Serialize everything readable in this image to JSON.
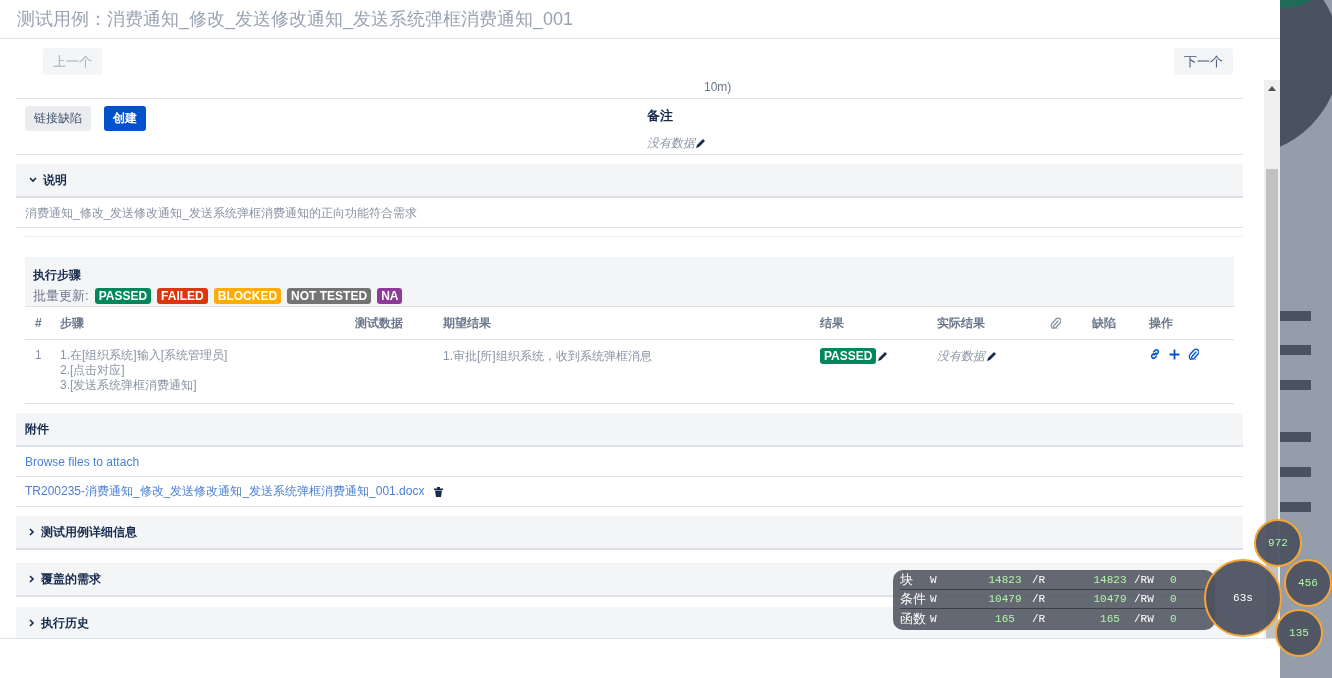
{
  "header": {
    "title": "测试用例：消费通知_修改_发送修改通知_发送系统弹框消费通知_001"
  },
  "nav": {
    "prev": {
      "label": "上一个",
      "disabled": true
    },
    "next": {
      "label": "下一个",
      "disabled": false
    },
    "cut_text": "10m)"
  },
  "defect_buttons": [
    {
      "label": "链接缺陷",
      "kind": "secondary"
    },
    {
      "label": "创建",
      "kind": "primary"
    }
  ],
  "notes": {
    "label": "备注",
    "value": "没有数据"
  },
  "description": {
    "title": "说明",
    "expanded": true,
    "text": "消费通知_修改_发送修改通知_发送系统弹框消费通知的正向功能符合需求"
  },
  "steps": {
    "title": "执行步骤",
    "bulk_label": "批量更新:",
    "statuses": [
      {
        "label": "PASSED",
        "color": "#00875a"
      },
      {
        "label": "FAILED",
        "color": "#de350b"
      },
      {
        "label": "BLOCKED",
        "color": "#ffab00"
      },
      {
        "label": "NOT TESTED",
        "color": "#737373"
      },
      {
        "label": "NA",
        "color": "#8e3a9d"
      }
    ],
    "columns": [
      {
        "kind": "text",
        "label": "#"
      },
      {
        "kind": "text",
        "label": "步骤"
      },
      {
        "kind": "text",
        "label": "测试数据"
      },
      {
        "kind": "text",
        "label": "期望结果"
      },
      {
        "kind": "text",
        "label": "结果"
      },
      {
        "kind": "text",
        "label": "实际结果"
      },
      {
        "kind": "icon"
      },
      {
        "kind": "text",
        "label": "缺陷"
      },
      {
        "kind": "text",
        "label": "操作"
      }
    ],
    "rows": [
      {
        "number": "1",
        "step_lines": [
          "1.在[组织系统]输入[系统管理员]",
          "2.[点击对应]",
          "3.[发送系统弹框消费通知]"
        ],
        "expected": "1.审批[所]组织系统，收到系统弹框消息",
        "result": {
          "label": "PASSED",
          "color": "#00875a"
        },
        "actual": "没有数据"
      }
    ]
  },
  "attachments": {
    "title": "附件",
    "browse_link": "Browse files to attach",
    "files": [
      "TR200235-消费通知_修改_发送修改通知_发送系统弹框消费通知_001.docx"
    ]
  },
  "collapsed_sections": [
    {
      "title": "测试用例详细信息",
      "expanded": false
    },
    {
      "title": "覆盖的需求",
      "expanded": false
    },
    {
      "title": "执行历史",
      "expanded": false
    }
  ],
  "debug_overlay": {
    "rows": [
      {
        "label": "块",
        "cells": [
          {
            "prefix": "W",
            "value": "14823"
          },
          {
            "prefix": "/R",
            "value": "14823"
          },
          {
            "prefix": "/RW",
            "value": "0"
          }
        ]
      },
      {
        "label": "条件",
        "cells": [
          {
            "prefix": "W",
            "value": "10479"
          },
          {
            "prefix": "/R",
            "value": "10479"
          },
          {
            "prefix": "/RW",
            "value": "0"
          }
        ]
      },
      {
        "label": "函数",
        "cells": [
          {
            "prefix": "W",
            "value": "165"
          },
          {
            "prefix": "/R",
            "value": "165"
          },
          {
            "prefix": "/RW",
            "value": "0"
          }
        ]
      }
    ],
    "bubbles": [
      {
        "value": "972",
        "kind": "small"
      },
      {
        "value": "456",
        "kind": "small"
      },
      {
        "value": "63s",
        "kind": "large"
      },
      {
        "value": "135",
        "kind": "small"
      }
    ]
  }
}
